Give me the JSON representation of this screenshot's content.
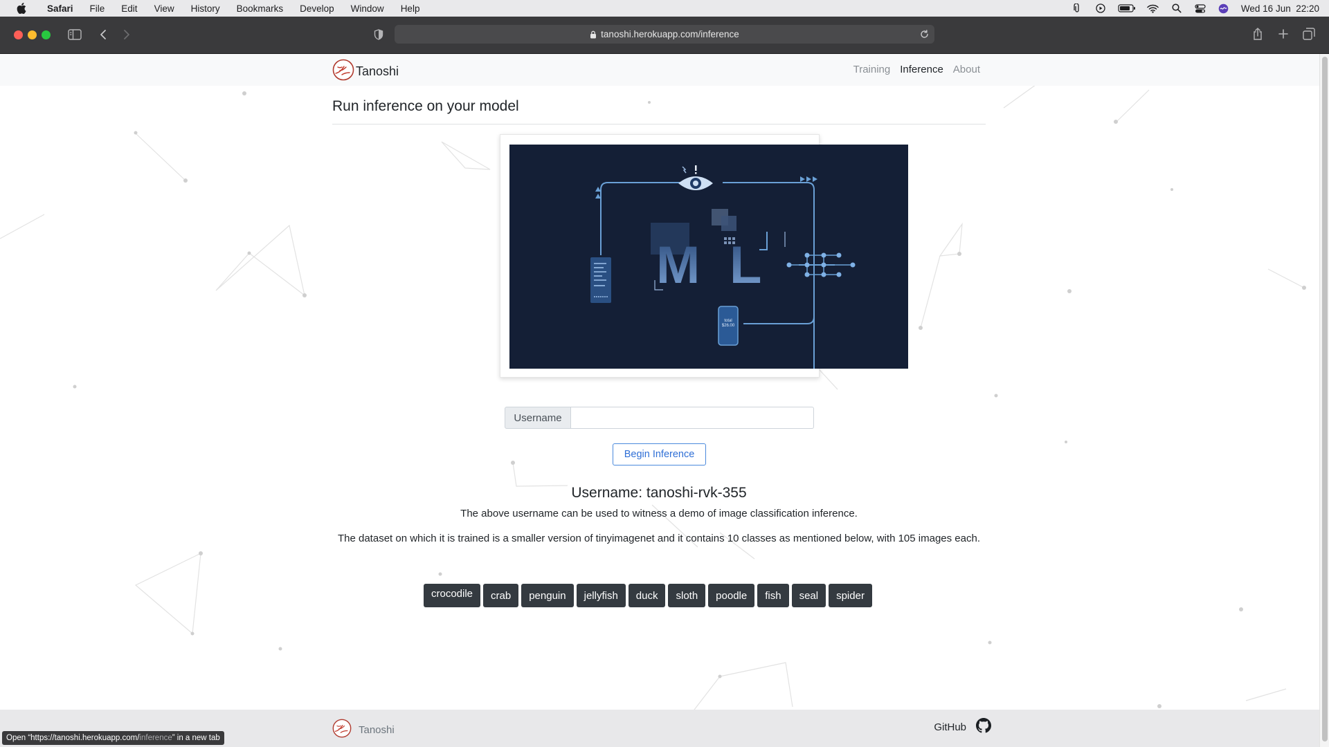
{
  "menubar": {
    "app": "Safari",
    "items": [
      "File",
      "Edit",
      "View",
      "History",
      "Bookmarks",
      "Develop",
      "Window",
      "Help"
    ],
    "clock": "Wed 16 Jun  22:20"
  },
  "browser": {
    "url": "tanoshi.herokuapp.com/inference",
    "status_prefix": "Open “https://tanoshi.herokuapp.com/",
    "status_path": "inference",
    "status_suffix": "” in a new tab"
  },
  "navbar": {
    "brand": "Tanoshi",
    "links": [
      {
        "label": "Training",
        "active": false
      },
      {
        "label": "Inference",
        "active": true
      },
      {
        "label": "About",
        "active": false
      }
    ]
  },
  "main": {
    "heading": "Run inference on your model",
    "image_labels": {
      "letter_m": "M",
      "letter_l": "L",
      "phone_text": "total\n$26.00"
    },
    "username_label": "Username",
    "username_value": "",
    "begin_button": "Begin Inference",
    "username_heading": "Username: tanoshi-rvk-355",
    "desc1": "The above username can be used to witness a demo of image classification inference.",
    "desc2": "The dataset on which it is trained is a smaller version of tinyimagenet and it contains 10 classes as mentioned below, with 105 images each.",
    "classes": [
      "crocodile",
      "crab",
      "penguin",
      "jellyfish",
      "duck",
      "sloth",
      "poodle",
      "fish",
      "seal",
      "spider"
    ]
  },
  "footer": {
    "brand": "Tanoshi",
    "github": "GitHub"
  },
  "colors": {
    "accent": "#2f6fd6",
    "tag_bg": "#343a40",
    "brand_red": "#c0392b",
    "image_bg": "#141f36"
  }
}
